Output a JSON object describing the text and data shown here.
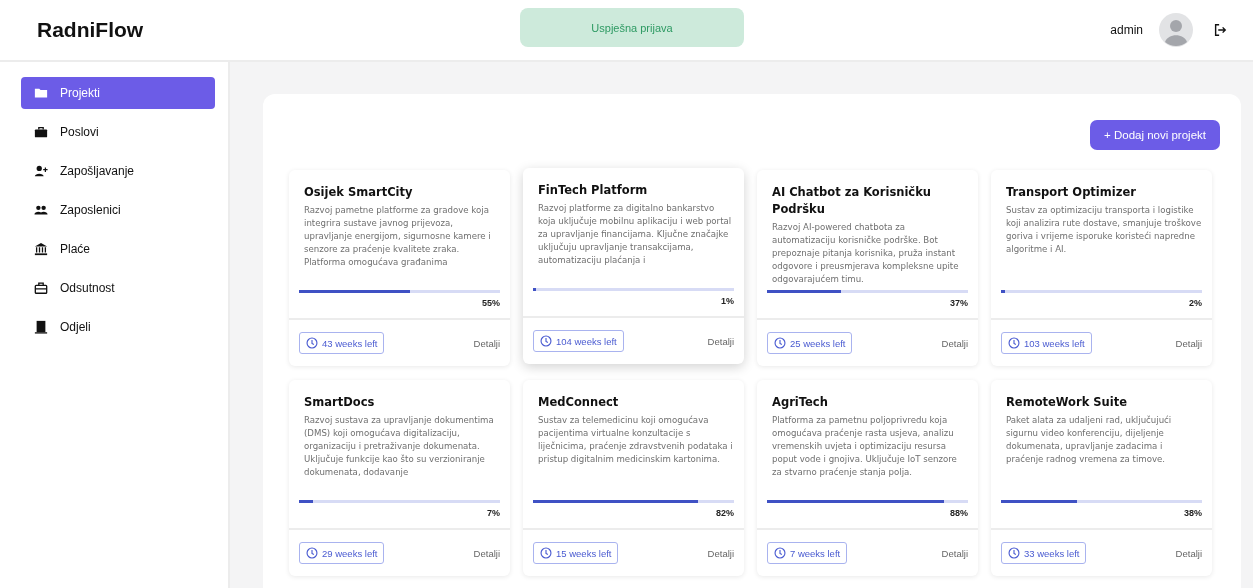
{
  "header": {
    "logo": "RadniFlow",
    "toast": "Uspješna prijava",
    "user": "admin"
  },
  "sidebar": {
    "items": [
      {
        "label": "Projekti",
        "selected": true
      },
      {
        "label": "Poslovi",
        "selected": false
      },
      {
        "label": "Zapošljavanje",
        "selected": false
      },
      {
        "label": "Zaposlenici",
        "selected": false
      },
      {
        "label": "Plaće",
        "selected": false
      },
      {
        "label": "Odsutnost",
        "selected": false
      },
      {
        "label": "Odjeli",
        "selected": false
      }
    ]
  },
  "add_button": "+ Dodaj novi projekt",
  "projects": [
    {
      "title": "Osijek SmartCity",
      "description": "Razvoj pametne platforme za gradove koja integrira sustave javnog prijevoza, upravljanje energijom, sigurnosne kamere i senzore za praćenje kvalitete zraka. Platforma omogućava građanima",
      "level": 0.55,
      "percent": "55%",
      "time_left": "43 weeks left",
      "details": "Detalji",
      "raised": false
    },
    {
      "title": "FinTech Platform",
      "description": "Razvoj platforme za digitalno bankarstvo koja uključuje mobilnu aplikaciju i web portal za upravljanje financijama. Ključne značajke uključuju upravljanje transakcijama, automatizaciju plaćanja i",
      "level": 0.01,
      "percent": "1%",
      "time_left": "104 weeks left",
      "details": "Detalji",
      "raised": true
    },
    {
      "title": "AI Chatbot za Korisničku Podršku",
      "description": "Razvoj AI-powered chatbota za automatizaciju korisničke podrške. Bot prepoznaje pitanja korisnika, pruža instant odgovore i preusmjerava kompleksne upite odgovarajućem timu.",
      "level": 0.37,
      "percent": "37%",
      "time_left": "25 weeks left",
      "details": "Detalji",
      "raised": false
    },
    {
      "title": "Transport Optimizer",
      "description": "Sustav za optimizaciju transporta i logistike koji analizira rute dostave, smanjuje troškove goriva i vrijeme isporuke koristeći napredne algoritme i AI.",
      "level": 0.02,
      "percent": "2%",
      "time_left": "103 weeks left",
      "details": "Detalji",
      "raised": false
    },
    {
      "title": "SmartDocs",
      "description": "Razvoj sustava za upravljanje dokumentima (DMS) koji omogućava digitalizaciju, organizaciju i pretraživanje dokumenata. Uključuje funkcije kao što su verzioniranje dokumenata, dodavanje",
      "level": 0.07,
      "percent": "7%",
      "time_left": "29 weeks left",
      "details": "Detalji",
      "raised": false
    },
    {
      "title": "MedConnect",
      "description": "Sustav za telemedicinu koji omogućava pacijentima virtualne konzultacije s liječnicima, praćenje zdravstvenih podataka i pristup digitalnim medicinskim kartonima.",
      "level": 0.82,
      "percent": "82%",
      "time_left": "15 weeks left",
      "details": "Detalji",
      "raised": false
    },
    {
      "title": "AgriTech",
      "description": "Platforma za pametnu poljoprivredu koja omogućava praćenje rasta usjeva, analizu vremenskih uvjeta i optimizaciju resursa poput vode i gnojiva. Uključuje IoT senzore za stvarno praćenje stanja polja.",
      "level": 0.88,
      "percent": "88%",
      "time_left": "7 weeks left",
      "details": "Detalji",
      "raised": false
    },
    {
      "title": "RemoteWork Suite",
      "description": "Paket alata za udaljeni rad, uključujući sigurnu video konferenciju, dijeljenje dokumenata, upravljanje zadacima i praćenje radnog vremena za timove.",
      "level": 0.38,
      "percent": "38%",
      "time_left": "33 weeks left",
      "details": "Detalji",
      "raised": false
    }
  ]
}
